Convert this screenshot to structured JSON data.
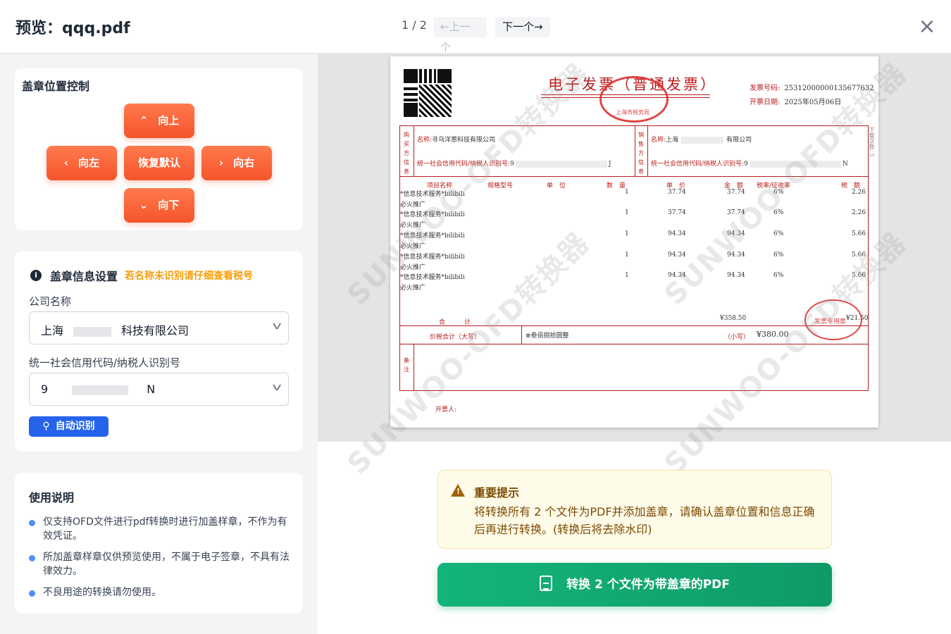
{
  "header": {
    "title": "预览：qqq.pdf",
    "pager": "1 / 2",
    "prev_label": "←上一个",
    "next_label": "下一个→",
    "close_icon": "×"
  },
  "position_card": {
    "title": "盖章位置控制",
    "up": "向上",
    "left": "向左",
    "reset": "恢复默认",
    "right": "向右",
    "down": "向下"
  },
  "info_card": {
    "title": "盖章信息设置",
    "hint": "若名称未识别请仔细查看税号",
    "company_label": "公司名称",
    "company_prefix": "上海",
    "company_suffix": "科技有限公司",
    "tax_label": "统一社会信用代码/纳税人识别号",
    "tax_prefix": "9",
    "tax_suffix": "N",
    "auto_btn": "自动识别"
  },
  "usage": {
    "title": "使用说明",
    "items": [
      "仅支持OFD文件进行pdf转换时进行加盖样章，不作为有效凭证。",
      "所加盖章样章仅供预览使用，不属于电子签章，不具有法律效力。",
      "不良用途的转换请勿使用。"
    ]
  },
  "invoice": {
    "title": "电子发票（普通发票）",
    "number_label": "发票号码:",
    "number": "25312000000135677632",
    "date_label": "开票日期:",
    "date": "2025年05月06日",
    "seal_top": "上海市税务局",
    "buyer_side": "购买方信息",
    "seller_side": "销售方信息",
    "buyer_name_label": "名称:",
    "buyer_name": "寻乌洋葱科技有限公司",
    "buyer_tax_label": "统一社会信用代码/纳税人识别号:",
    "buyer_tax_start": "9",
    "buyer_tax_end": "J",
    "seller_name_label": "名称:",
    "seller_name_start": "上海",
    "seller_name_end": "有限公司",
    "seller_tax_label": "统一社会信用代码/纳税人识别号:",
    "seller_tax_start": "9",
    "seller_tax_end": "N",
    "headers": {
      "item": "项目名称",
      "spec": "规格型号",
      "unit": "单　位",
      "qty": "数　量",
      "price": "单　价",
      "amount": "金　额",
      "rate": "税率/征收率",
      "tax": "税　额"
    },
    "items": [
      {
        "name1": "*信息技术服务*bilibili",
        "name2": "必火推广",
        "qty": "1",
        "price": "37.74",
        "amount": "37.74",
        "rate": "6%",
        "tax": "2.26"
      },
      {
        "name1": "*信息技术服务*bilibili",
        "name2": "必火推广",
        "qty": "1",
        "price": "37.74",
        "amount": "37.74",
        "rate": "6%",
        "tax": "2.26"
      },
      {
        "name1": "*信息技术服务*bilibili",
        "name2": "必火推广",
        "qty": "1",
        "price": "94.34",
        "amount": "94.34",
        "rate": "6%",
        "tax": "5.66"
      },
      {
        "name1": "*信息技术服务*bilibili",
        "name2": "必火推广",
        "qty": "1",
        "price": "94.34",
        "amount": "94.34",
        "rate": "6%",
        "tax": "5.66"
      },
      {
        "name1": "*信息技术服务*bilibili",
        "name2": "必火推广",
        "qty": "1",
        "price": "94.34",
        "amount": "94.34",
        "rate": "6%",
        "tax": "5.66"
      }
    ],
    "total_label": "合　　　计",
    "total_amount": "¥358.50",
    "total_tax": "¥21.50",
    "seal_bottom": "发票专用章",
    "sum_label": "价税合计（大写）",
    "sum_words": "⊗叁佰捌拾圆整",
    "small_label": "（小写）",
    "small_value": "¥380.00",
    "remark_label": "备注",
    "drawer_label": "开票人:",
    "side_note": "下载次数: 3"
  },
  "watermark": "SUNWOO-OFD转换器",
  "notice": {
    "title": "重要提示",
    "body": "将转换所有 2 个文件为PDF并添加盖章，请确认盖章位置和信息正确后再进行转换。(转换后将去除水印)"
  },
  "convert_button": "转换 2 个文件为带盖章的PDF",
  "colors": {
    "orange": "#f5542c",
    "blue": "#2563eb",
    "green": "#0f9a68",
    "invoice_red": "#b91c1c"
  }
}
